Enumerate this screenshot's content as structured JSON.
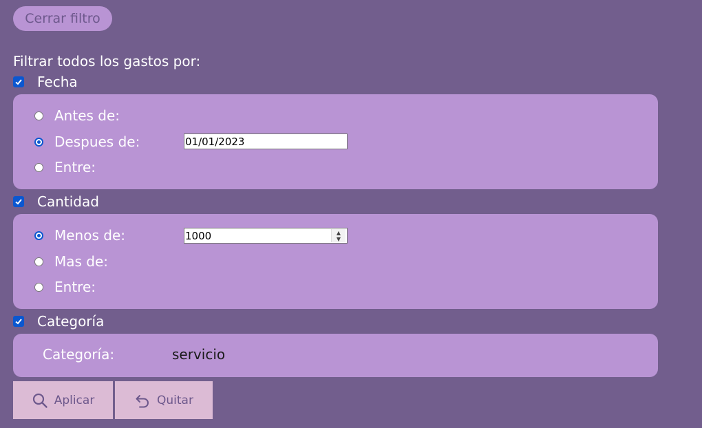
{
  "close_filter_label": "Cerrar filtro",
  "title": "Filtrar todos los gastos por:",
  "fecha": {
    "label": "Fecha",
    "checked": true,
    "options": [
      "Antes de:",
      "Despues de:",
      "Entre:"
    ],
    "selected": "Despues de:",
    "date_value": "01/01/2023"
  },
  "cantidad": {
    "label": "Cantidad",
    "checked": true,
    "options": [
      "Menos de:",
      "Mas de:",
      "Entre:"
    ],
    "selected": "Menos de:",
    "amount_value": "1000"
  },
  "categoria": {
    "label": "Categoría",
    "checked": true,
    "field_label": "Categoría:",
    "value": "servicio"
  },
  "actions": {
    "apply_label": "Aplicar",
    "apply_icon": "search-icon",
    "remove_label": "Quitar",
    "remove_icon": "undo-icon"
  },
  "colors": {
    "background": "#725e8d",
    "panel": "#b994d4",
    "button": "#dcbbd5",
    "accent": "#0b57d0"
  }
}
